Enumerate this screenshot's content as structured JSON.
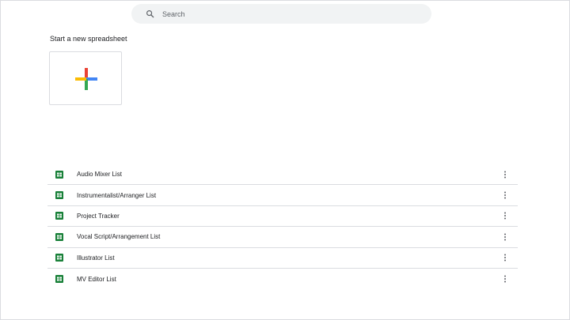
{
  "search": {
    "placeholder": "Search"
  },
  "new_section": {
    "title": "Start a new spreadsheet"
  },
  "colors": {
    "search_bg": "#f1f3f4",
    "sheets_green": "#188038",
    "plus_red": "#ea4335",
    "plus_blue": "#4285f4",
    "plus_yellow": "#fbbc04",
    "plus_green": "#34a853"
  },
  "files": [
    {
      "name": "Audio Mixer List",
      "icon": "sheets-icon"
    },
    {
      "name": "Instrumentalist/Arranger List",
      "icon": "sheets-icon"
    },
    {
      "name": "Project Tracker",
      "icon": "sheets-icon"
    },
    {
      "name": "Vocal Script/Arrangement List",
      "icon": "sheets-icon"
    },
    {
      "name": "Illustrator List",
      "icon": "sheets-icon"
    },
    {
      "name": "MV Editor List",
      "icon": "sheets-icon"
    }
  ]
}
